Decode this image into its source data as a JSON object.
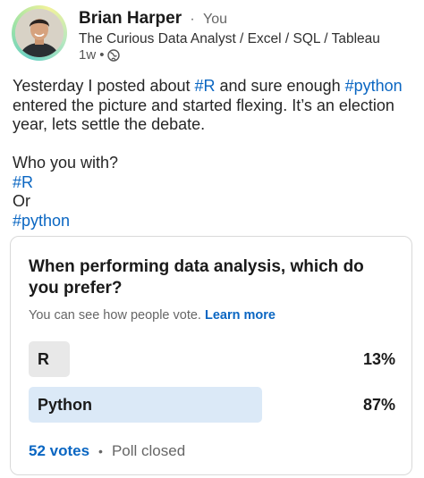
{
  "author": {
    "name": "Brian Harper",
    "separator": "·",
    "relation": "You",
    "headline": "The Curious Data Analyst / Excel / SQL / Tableau",
    "time": "1w",
    "visibility_icon": "globe-icon"
  },
  "post": {
    "line1_before": "Yesterday I posted about ",
    "line1_tag": "#R",
    "line1_after": " and sure enough ",
    "line2_tag": "#python",
    "line2_after": " entered the picture and started flexing. It’s an election year, lets settle the debate.",
    "question": "Who you with?",
    "tag_r": "#R",
    "or": "Or",
    "tag_python": "#python"
  },
  "poll": {
    "question": "When performing data analysis, which do you prefer?",
    "note": "You can see how people vote.",
    "learn_more": "Learn more",
    "options": [
      {
        "label": "R",
        "percent": "13%",
        "share": 0.13
      },
      {
        "label": "Python",
        "percent": "87%",
        "share": 0.87
      }
    ],
    "votes": "52 votes",
    "separator": "•",
    "status": "Poll closed"
  },
  "colors": {
    "accent": "#0a66c2",
    "bar_default": "#e8e8e8",
    "bar_winner": "#dbe9f7"
  }
}
